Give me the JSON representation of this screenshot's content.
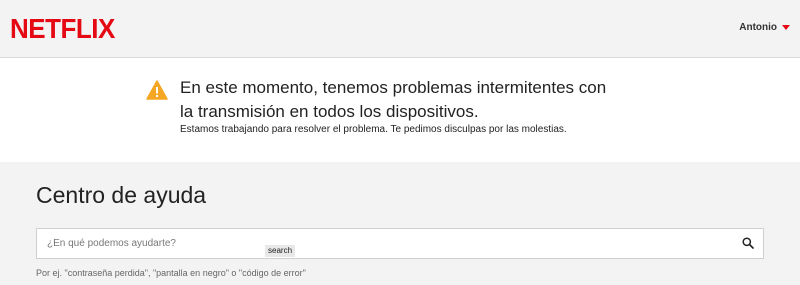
{
  "header": {
    "logo": "NETFLIX",
    "profile_name": "Antonio"
  },
  "alert": {
    "title": "En este momento, tenemos problemas intermitentes con la transmisión en todos los dispositivos.",
    "subtitle": "Estamos trabajando para resolver el problema. Te pedimos disculpas por las molestias.",
    "icon": "warning-icon"
  },
  "help": {
    "title": "Centro de ayuda",
    "search_placeholder": "¿En qué podemos ayudarte?",
    "search_button": "search",
    "hint": "Por ej. \"contraseña perdida\", \"pantalla en negro\" o \"código de error\""
  },
  "colors": {
    "brand": "#e50914",
    "warning": "#f5a623",
    "header_bg": "#f3f3f3"
  }
}
